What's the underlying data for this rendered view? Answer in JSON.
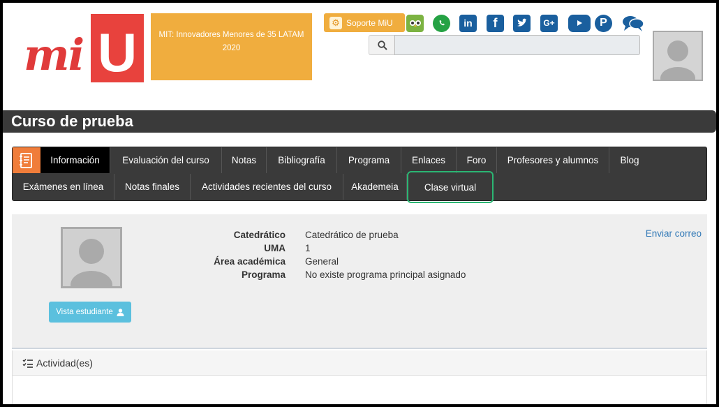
{
  "logo": {
    "text_mi": "mi",
    "text_u": "U"
  },
  "promo": {
    "text": "MIT: Innovadores Menores de 35 LATAM 2020"
  },
  "support_button": {
    "label": "Soporte MiU",
    "icon": "gear-icon"
  },
  "social_icons": [
    "owl-icon",
    "whatsapp-icon",
    "linkedin-icon",
    "facebook-icon",
    "twitter-icon",
    "google-plus-icon",
    "youtube-icon",
    "pinterest-icon",
    "chat-icon"
  ],
  "search": {
    "value": "",
    "icon": "search-icon"
  },
  "course": {
    "title": "Curso de prueba"
  },
  "nav": {
    "row1": [
      "Información",
      "Evaluación del curso",
      "Notas",
      "Bibliografía",
      "Programa",
      "Enlaces",
      "Foro",
      "Profesores y alumnos",
      "Blog"
    ],
    "row2": [
      "Exámenes en línea",
      "Notas finales",
      "Actividades recientes del curso",
      "Akademeia",
      "Clase virtual"
    ],
    "active": "Información",
    "highlighted": "Clase virtual"
  },
  "info": {
    "rows": [
      {
        "label": "Catedrático",
        "value": "Catedrático de prueba"
      },
      {
        "label": "UMA",
        "value": "1"
      },
      {
        "label": "Área académica",
        "value": "General"
      },
      {
        "label": "Programa",
        "value": "No existe programa principal asignado"
      }
    ],
    "email_link": "Enviar correo",
    "student_view_button": "Vista estudiante"
  },
  "activity": {
    "title": "Actividad(es)"
  },
  "colors": {
    "brand_red": "#e8423d",
    "orange": "#f0ad3e",
    "nav_dark": "#3a3a3a",
    "highlight_green": "#2bb673",
    "link_blue": "#337ab7"
  }
}
